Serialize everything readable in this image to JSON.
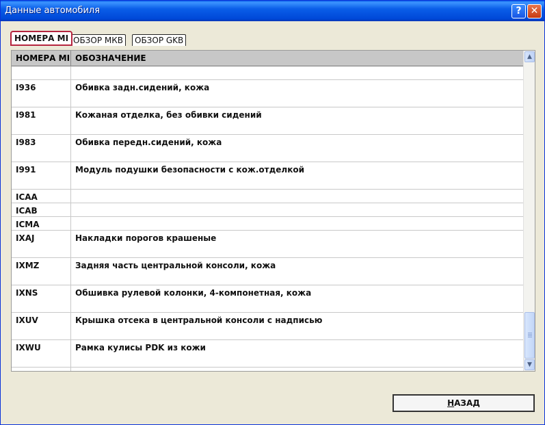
{
  "window": {
    "title": "Данные автомобиля",
    "help_label": "?",
    "close_label": "✕"
  },
  "tabs": [
    {
      "label": "НОМЕРА MI",
      "active": true
    },
    {
      "label": "ОБЗОР МКВ",
      "active": false
    },
    {
      "label": "ОБЗОР GKB",
      "active": false
    }
  ],
  "table": {
    "headers": [
      "НОМЕРА MI",
      "ОБОЗНАЧЕНИЕ"
    ],
    "rows": [
      {
        "code": "",
        "desc": ""
      },
      {
        "code": "I936",
        "desc": "Обивка задн.сидений, кожа"
      },
      {
        "code": "I981",
        "desc": "Кожаная отделка, без обивки сидений"
      },
      {
        "code": "I983",
        "desc": "Обивка передн.сидений, кожа"
      },
      {
        "code": "I991",
        "desc": "Модуль подушки безопасности с кож.отделкой"
      },
      {
        "code": "ICAA",
        "desc": ""
      },
      {
        "code": "ICAB",
        "desc": ""
      },
      {
        "code": "ICMA",
        "desc": ""
      },
      {
        "code": "IXAJ",
        "desc": "Накладки порогов крашеные"
      },
      {
        "code": "IXMZ",
        "desc": "Задняя часть центральной консоли, кожа"
      },
      {
        "code": "IXNS",
        "desc": "Обшивка рулевой колонки, 4-компонетная, кожа"
      },
      {
        "code": "IXUV",
        "desc": "Крышка отсека в центральной консоли с надписью"
      },
      {
        "code": "IXWU",
        "desc": "Рамка кулисы PDK из кожи"
      },
      {
        "code": "",
        "desc": ""
      }
    ]
  },
  "scrollbar": {
    "up_icon": "▲",
    "down_icon": "▼"
  },
  "footer": {
    "back_label_accel": "Н",
    "back_label_rest": "АЗАД"
  }
}
